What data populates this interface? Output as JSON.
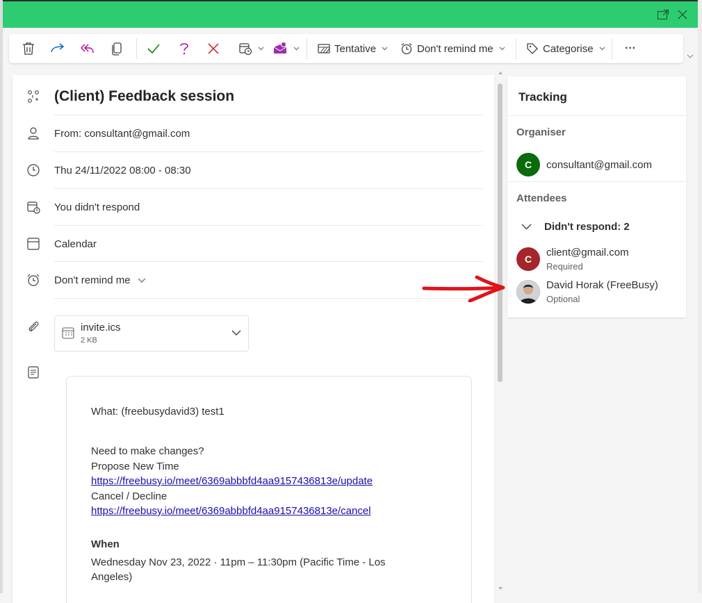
{
  "colors": {
    "titlebar": "#2ecc71",
    "accept": "#107c10",
    "decline": "#d13438",
    "tentative": "#b4009e",
    "forward": "#0f6cbd",
    "avatar_green": "#0b6a0b",
    "avatar_red": "#a4262c",
    "arrow": "#e0141a"
  },
  "toolbar": {
    "icons": [
      "delete-icon",
      "forward-icon",
      "reply-all-icon",
      "copy-icon",
      "accept-icon",
      "tentative-icon",
      "decline-icon",
      "calendar-clock-icon",
      "teams-meeting-icon"
    ],
    "tentative_label": "Tentative",
    "reminder_label": "Don't remind me",
    "categorise_label": "Categorise",
    "more_label": "···"
  },
  "event": {
    "subject": "(Client) Feedback session",
    "from": "From: consultant@gmail.com",
    "datetime": "Thu 24/11/2022 08:00 - 08:30",
    "response": "You didn't respond",
    "calendar": "Calendar",
    "reminder": "Don't remind me",
    "attachment": {
      "name": "invite.ics",
      "size": "2 KB"
    }
  },
  "body": {
    "what": "What: (freebusydavid3) test1",
    "need_changes": "Need to make changes?",
    "propose": "Propose New Time",
    "propose_link": "https://freebusy.io/meet/6369abbbfd4aa9157436813e/update",
    "cancel": "Cancel / Decline",
    "cancel_link": "https://freebusy.io/meet/6369abbbfd4aa9157436813e/cancel",
    "when_heading": "When",
    "when_line1": "Wednesday Nov 23, 2022 · 11pm – 11:30pm (Pacific Time - Los",
    "when_line2": "Angeles)"
  },
  "tracking": {
    "title": "Tracking",
    "organiser_heading": "Organiser",
    "organiser": {
      "initial": "C",
      "email": "consultant@gmail.com"
    },
    "attendees_heading": "Attendees",
    "didnt_respond": "Didn't respond: 2",
    "attendees": [
      {
        "initial": "C",
        "name": "client@gmail.com",
        "role": "Required"
      },
      {
        "initial": "",
        "name": "David Horak (FreeBusy)",
        "role": "Optional"
      }
    ]
  }
}
